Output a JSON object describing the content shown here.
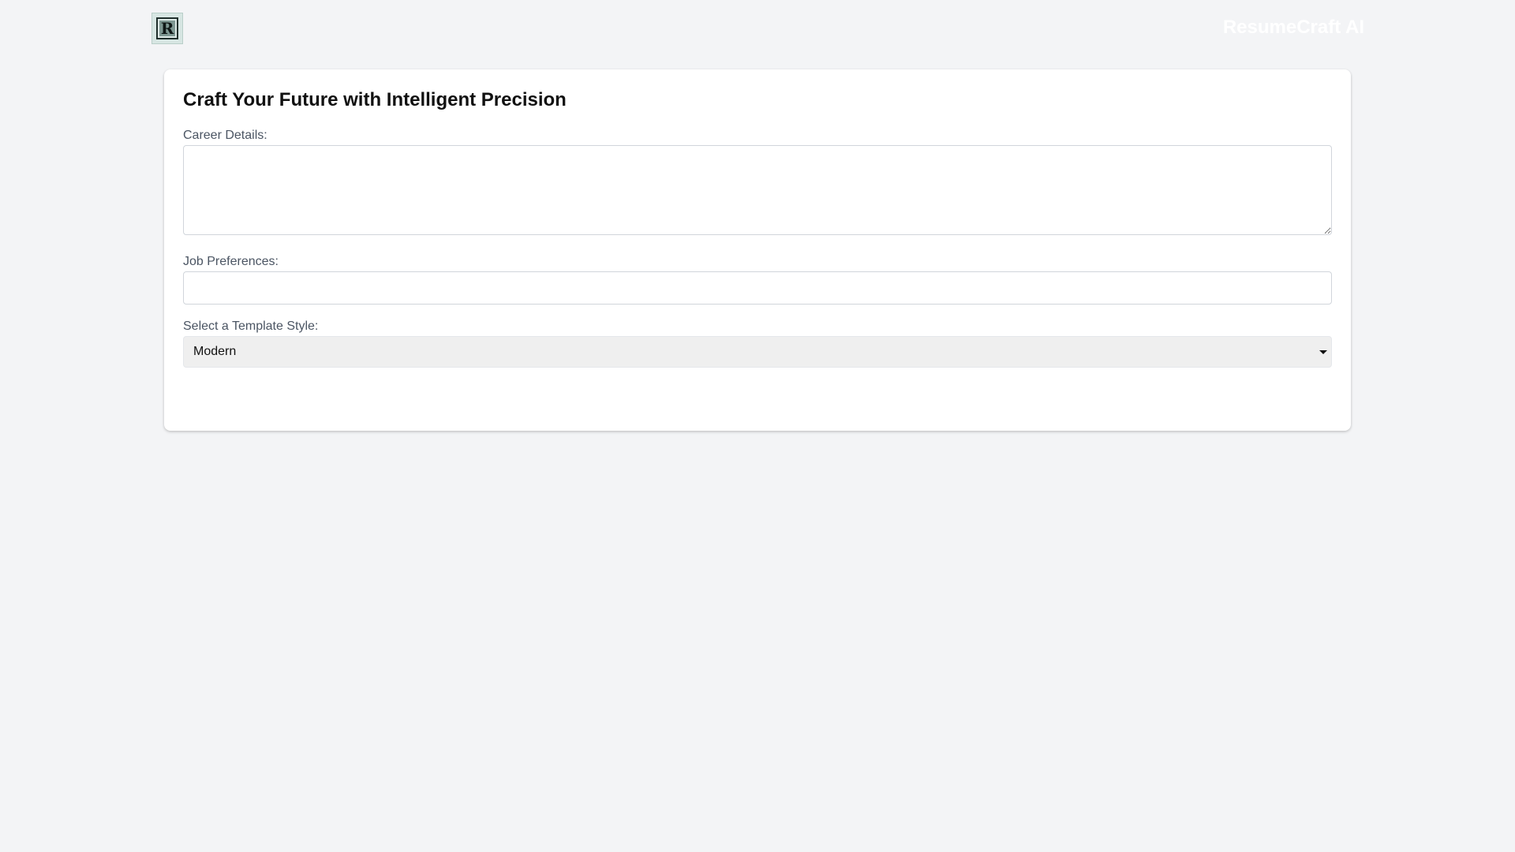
{
  "header": {
    "logo_icon": "monogram-r-logo",
    "logo_text": "R",
    "brand_title": "ResumeCraft AI"
  },
  "form": {
    "title": "Craft Your Future with Intelligent Precision",
    "career_details": {
      "label": "Career Details:",
      "value": "",
      "placeholder": ""
    },
    "job_preferences": {
      "label": "Job Preferences:",
      "value": "",
      "placeholder": ""
    },
    "template_style": {
      "label": "Select a Template Style:",
      "selected": "Modern",
      "icon": "chevron-down-icon"
    }
  },
  "colors": {
    "page_background": "#f3f4f6",
    "card_background": "#ffffff",
    "text_primary": "#111111",
    "label_text": "#4b5563",
    "input_border": "#d1d5db",
    "select_background": "#efefef",
    "brand_text": "#ffffff"
  }
}
